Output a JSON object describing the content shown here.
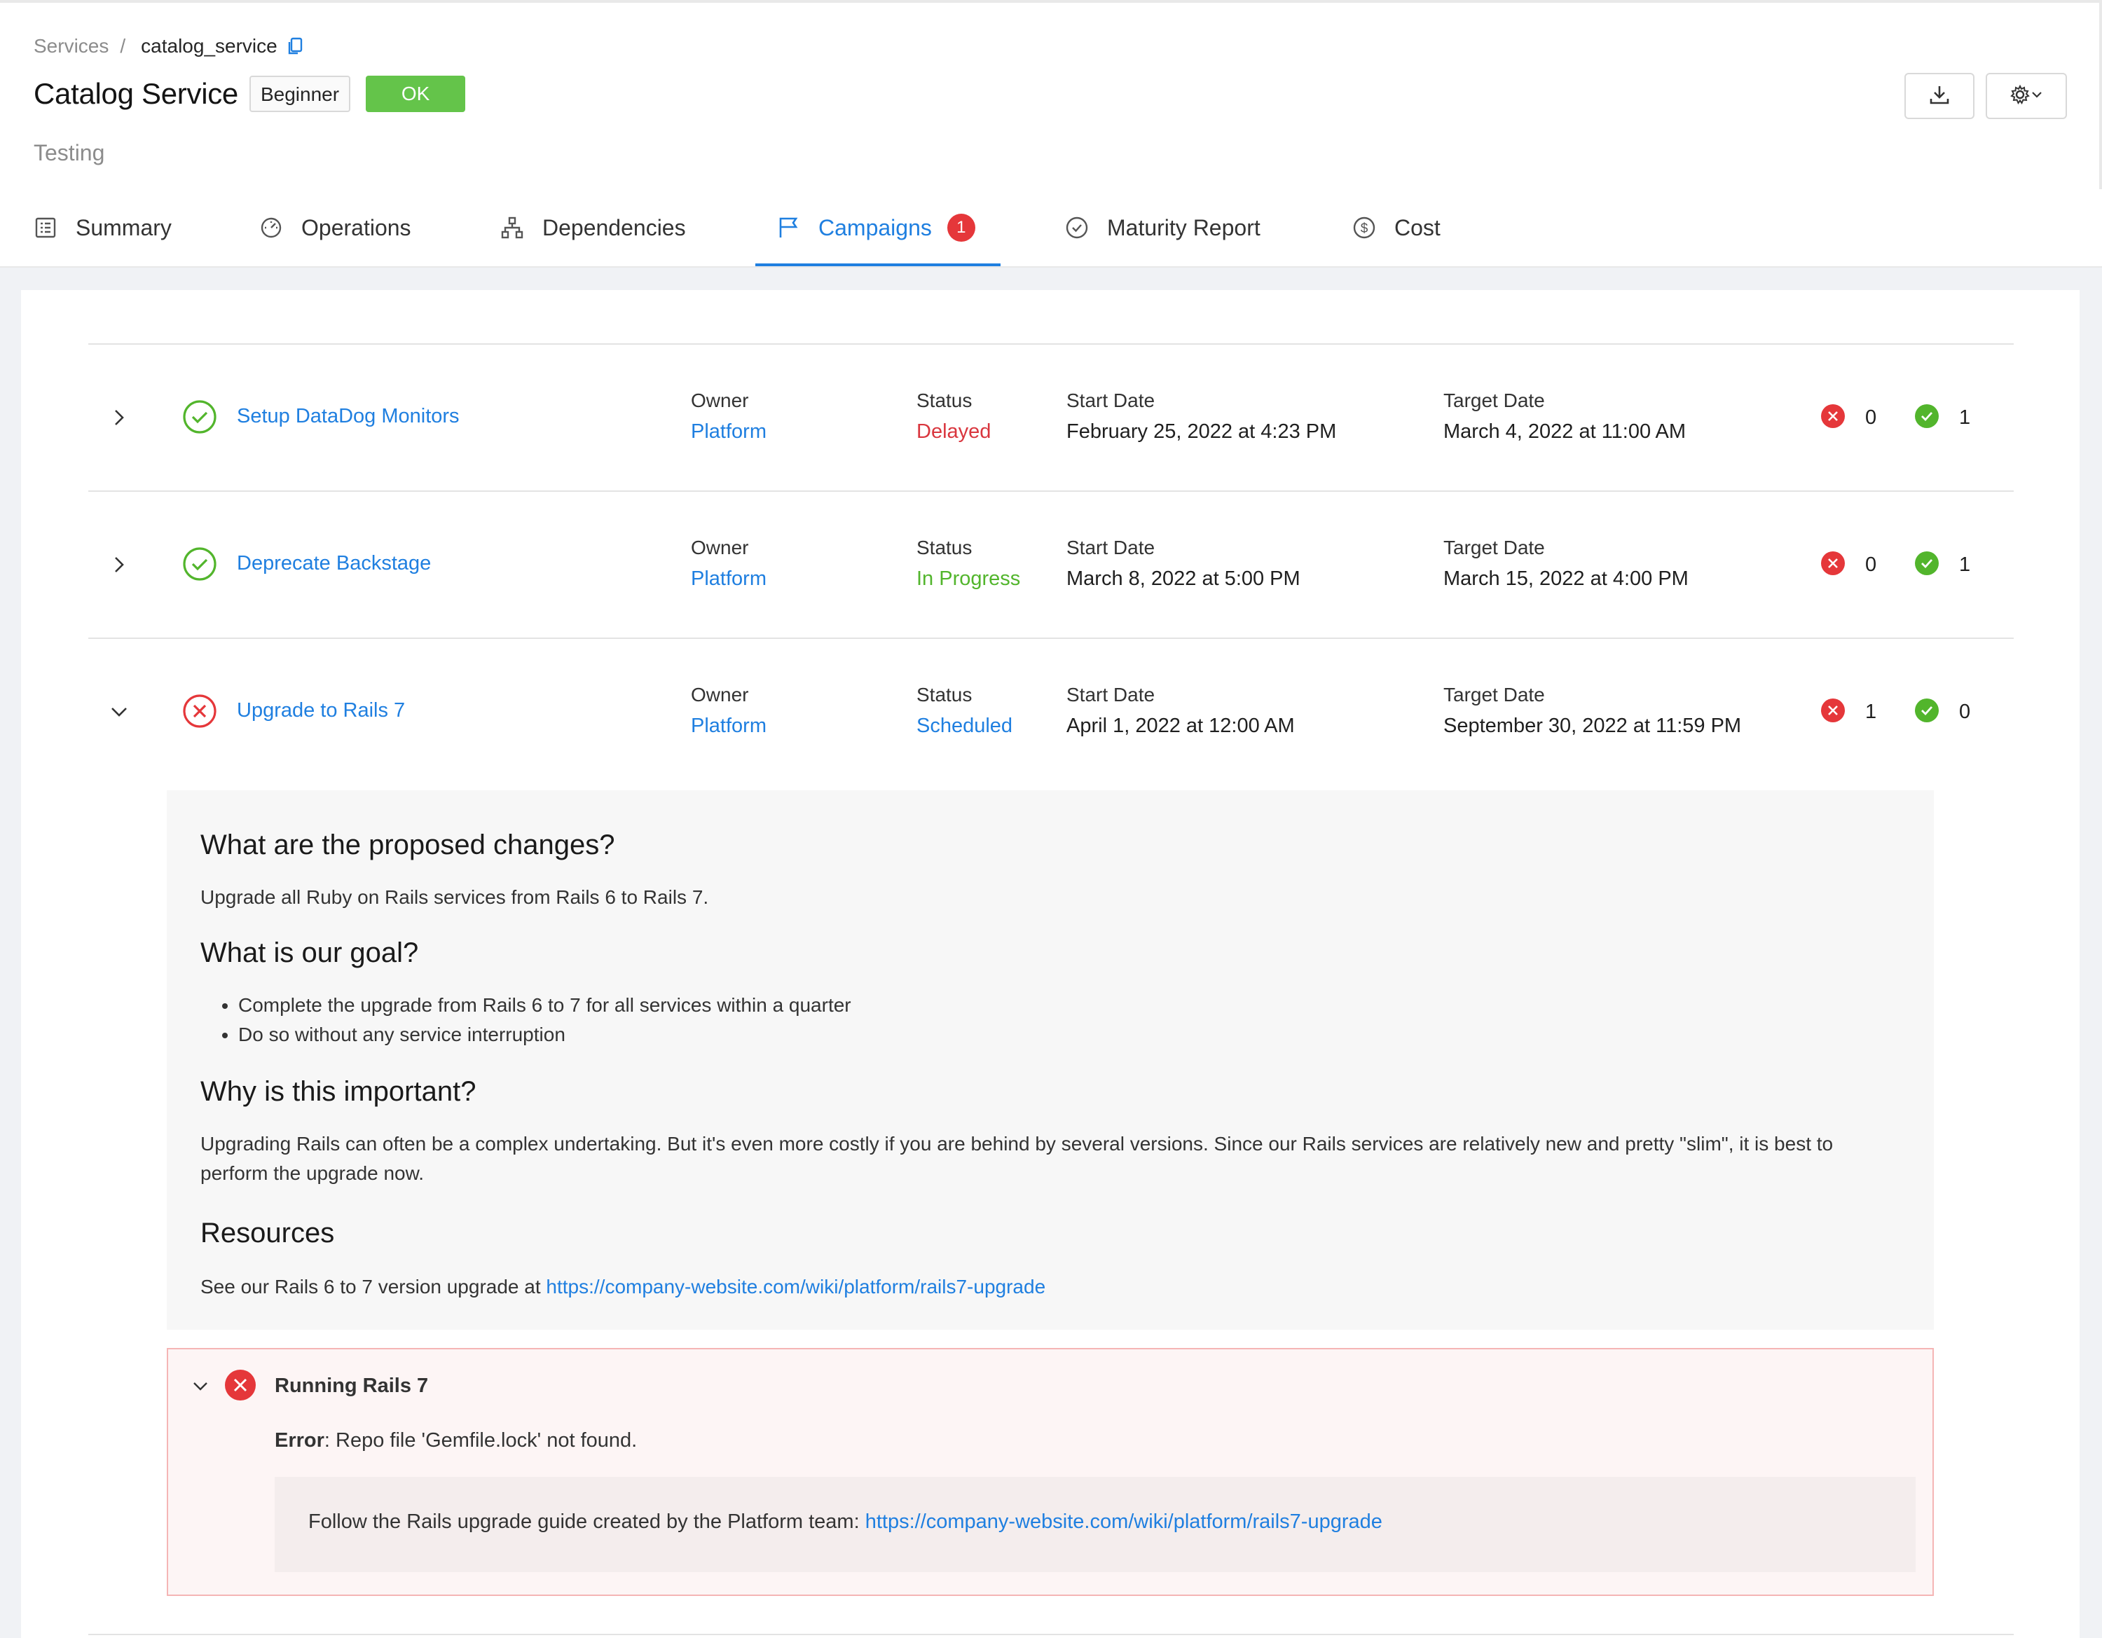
{
  "breadcrumb": {
    "root": "Services",
    "separator": "/",
    "current": "catalog_service"
  },
  "service": {
    "title": "Catalog Service",
    "level_tag": "Beginner",
    "status_tag": "OK",
    "subtitle": "Testing"
  },
  "tabs": [
    {
      "label": "Summary",
      "icon": "list-icon"
    },
    {
      "label": "Operations",
      "icon": "dashboard-icon"
    },
    {
      "label": "Dependencies",
      "icon": "hierarchy-icon"
    },
    {
      "label": "Campaigns",
      "icon": "flag-icon",
      "badge": "1",
      "active": true
    },
    {
      "label": "Maturity Report",
      "icon": "check-circle-icon"
    },
    {
      "label": "Cost",
      "icon": "dollar-circle-icon"
    }
  ],
  "labels": {
    "owner": "Owner",
    "status": "Status",
    "start": "Start Date",
    "target": "Target Date"
  },
  "campaigns": [
    {
      "name": "Setup DataDog Monitors",
      "state": "passing",
      "owner": "Platform",
      "status": "Delayed",
      "start_date": "February 25, 2022 at 4:23 PM",
      "target_date": "March 4, 2022 at 11:00 AM",
      "failing": "0",
      "passing": "1"
    },
    {
      "name": "Deprecate Backstage",
      "state": "passing",
      "owner": "Platform",
      "status": "In Progress",
      "start_date": "March 8, 2022 at 5:00 PM",
      "target_date": "March 15, 2022 at 4:00 PM",
      "failing": "0",
      "passing": "1"
    },
    {
      "name": "Upgrade to Rails 7",
      "state": "failing",
      "owner": "Platform",
      "status": "Scheduled",
      "start_date": "April 1, 2022 at 12:00 AM",
      "target_date": "September 30, 2022 at 11:59 PM",
      "failing": "1",
      "passing": "0"
    }
  ],
  "details": {
    "h_changes": "What are the proposed changes?",
    "changes": "Upgrade all Ruby on Rails services from Rails 6 to Rails 7.",
    "h_goal": "What is our goal?",
    "goals": [
      "Complete the upgrade from Rails 6 to 7 for all services within a quarter",
      "Do so without any service interruption"
    ],
    "h_important": "Why is this important?",
    "important_line1": "Upgrading Rails can often be a complex undertaking. But it's even more costly if you are behind by several versions. Since our Rails services are relatively new and pretty \"slim\", it is best to",
    "important_line2": "perform the upgrade now.",
    "h_resources": "Resources",
    "resources_text": "See our Rails 6 to 7 version upgrade at ",
    "resources_link": "https://company-website.com/wiki/platform/rails7-upgrade"
  },
  "check": {
    "title": "Running Rails 7",
    "error_label": "Error",
    "error_text": ": Repo file 'Gemfile.lock' not found.",
    "guide_text": "Follow the Rails upgrade guide created by the Platform team: ",
    "guide_link": "https://company-website.com/wiki/platform/rails7-upgrade"
  },
  "colors": {
    "accent": "#1f7fe0",
    "ok": "#64c44a",
    "error": "#e5373a",
    "delayed": "#d9363e",
    "in_progress": "#52b52c"
  }
}
